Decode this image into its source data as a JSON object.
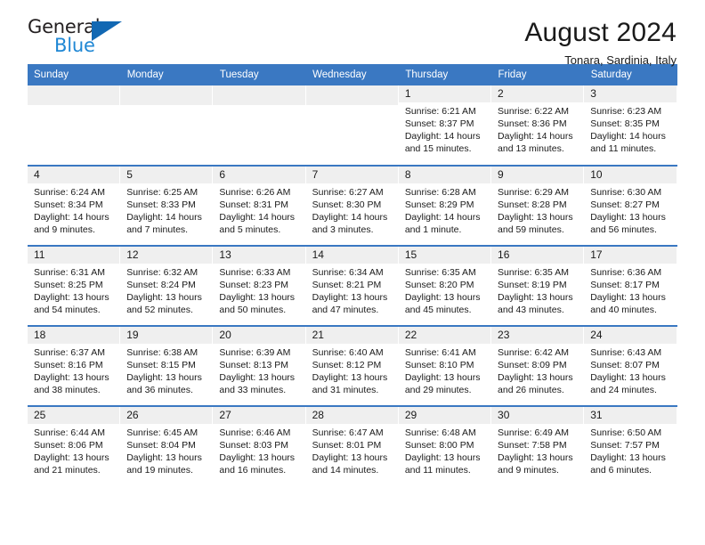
{
  "brand": {
    "name_top": "General",
    "name_bottom": "Blue",
    "triangle_color": "#1268b3",
    "blue_color": "#1f87d4"
  },
  "header": {
    "title": "August 2024",
    "subtitle": "Tonara, Sardinia, Italy"
  },
  "theme": {
    "header_bg": "#3a78c2",
    "header_text": "#ffffff",
    "daynum_bg": "#efefef",
    "row_divider": "#3a78c2"
  },
  "calendar": {
    "weekdays": [
      "Sunday",
      "Monday",
      "Tuesday",
      "Wednesday",
      "Thursday",
      "Friday",
      "Saturday"
    ],
    "weeks": [
      [
        {
          "day": "",
          "sunrise": "",
          "sunset": "",
          "daylight": "",
          "empty": true
        },
        {
          "day": "",
          "sunrise": "",
          "sunset": "",
          "daylight": "",
          "empty": true
        },
        {
          "day": "",
          "sunrise": "",
          "sunset": "",
          "daylight": "",
          "empty": true
        },
        {
          "day": "",
          "sunrise": "",
          "sunset": "",
          "daylight": "",
          "empty": true
        },
        {
          "day": "1",
          "sunrise": "Sunrise: 6:21 AM",
          "sunset": "Sunset: 8:37 PM",
          "daylight": "Daylight: 14 hours and 15 minutes."
        },
        {
          "day": "2",
          "sunrise": "Sunrise: 6:22 AM",
          "sunset": "Sunset: 8:36 PM",
          "daylight": "Daylight: 14 hours and 13 minutes."
        },
        {
          "day": "3",
          "sunrise": "Sunrise: 6:23 AM",
          "sunset": "Sunset: 8:35 PM",
          "daylight": "Daylight: 14 hours and 11 minutes."
        }
      ],
      [
        {
          "day": "4",
          "sunrise": "Sunrise: 6:24 AM",
          "sunset": "Sunset: 8:34 PM",
          "daylight": "Daylight: 14 hours and 9 minutes."
        },
        {
          "day": "5",
          "sunrise": "Sunrise: 6:25 AM",
          "sunset": "Sunset: 8:33 PM",
          "daylight": "Daylight: 14 hours and 7 minutes."
        },
        {
          "day": "6",
          "sunrise": "Sunrise: 6:26 AM",
          "sunset": "Sunset: 8:31 PM",
          "daylight": "Daylight: 14 hours and 5 minutes."
        },
        {
          "day": "7",
          "sunrise": "Sunrise: 6:27 AM",
          "sunset": "Sunset: 8:30 PM",
          "daylight": "Daylight: 14 hours and 3 minutes."
        },
        {
          "day": "8",
          "sunrise": "Sunrise: 6:28 AM",
          "sunset": "Sunset: 8:29 PM",
          "daylight": "Daylight: 14 hours and 1 minute."
        },
        {
          "day": "9",
          "sunrise": "Sunrise: 6:29 AM",
          "sunset": "Sunset: 8:28 PM",
          "daylight": "Daylight: 13 hours and 59 minutes."
        },
        {
          "day": "10",
          "sunrise": "Sunrise: 6:30 AM",
          "sunset": "Sunset: 8:27 PM",
          "daylight": "Daylight: 13 hours and 56 minutes."
        }
      ],
      [
        {
          "day": "11",
          "sunrise": "Sunrise: 6:31 AM",
          "sunset": "Sunset: 8:25 PM",
          "daylight": "Daylight: 13 hours and 54 minutes."
        },
        {
          "day": "12",
          "sunrise": "Sunrise: 6:32 AM",
          "sunset": "Sunset: 8:24 PM",
          "daylight": "Daylight: 13 hours and 52 minutes."
        },
        {
          "day": "13",
          "sunrise": "Sunrise: 6:33 AM",
          "sunset": "Sunset: 8:23 PM",
          "daylight": "Daylight: 13 hours and 50 minutes."
        },
        {
          "day": "14",
          "sunrise": "Sunrise: 6:34 AM",
          "sunset": "Sunset: 8:21 PM",
          "daylight": "Daylight: 13 hours and 47 minutes."
        },
        {
          "day": "15",
          "sunrise": "Sunrise: 6:35 AM",
          "sunset": "Sunset: 8:20 PM",
          "daylight": "Daylight: 13 hours and 45 minutes."
        },
        {
          "day": "16",
          "sunrise": "Sunrise: 6:35 AM",
          "sunset": "Sunset: 8:19 PM",
          "daylight": "Daylight: 13 hours and 43 minutes."
        },
        {
          "day": "17",
          "sunrise": "Sunrise: 6:36 AM",
          "sunset": "Sunset: 8:17 PM",
          "daylight": "Daylight: 13 hours and 40 minutes."
        }
      ],
      [
        {
          "day": "18",
          "sunrise": "Sunrise: 6:37 AM",
          "sunset": "Sunset: 8:16 PM",
          "daylight": "Daylight: 13 hours and 38 minutes."
        },
        {
          "day": "19",
          "sunrise": "Sunrise: 6:38 AM",
          "sunset": "Sunset: 8:15 PM",
          "daylight": "Daylight: 13 hours and 36 minutes."
        },
        {
          "day": "20",
          "sunrise": "Sunrise: 6:39 AM",
          "sunset": "Sunset: 8:13 PM",
          "daylight": "Daylight: 13 hours and 33 minutes."
        },
        {
          "day": "21",
          "sunrise": "Sunrise: 6:40 AM",
          "sunset": "Sunset: 8:12 PM",
          "daylight": "Daylight: 13 hours and 31 minutes."
        },
        {
          "day": "22",
          "sunrise": "Sunrise: 6:41 AM",
          "sunset": "Sunset: 8:10 PM",
          "daylight": "Daylight: 13 hours and 29 minutes."
        },
        {
          "day": "23",
          "sunrise": "Sunrise: 6:42 AM",
          "sunset": "Sunset: 8:09 PM",
          "daylight": "Daylight: 13 hours and 26 minutes."
        },
        {
          "day": "24",
          "sunrise": "Sunrise: 6:43 AM",
          "sunset": "Sunset: 8:07 PM",
          "daylight": "Daylight: 13 hours and 24 minutes."
        }
      ],
      [
        {
          "day": "25",
          "sunrise": "Sunrise: 6:44 AM",
          "sunset": "Sunset: 8:06 PM",
          "daylight": "Daylight: 13 hours and 21 minutes."
        },
        {
          "day": "26",
          "sunrise": "Sunrise: 6:45 AM",
          "sunset": "Sunset: 8:04 PM",
          "daylight": "Daylight: 13 hours and 19 minutes."
        },
        {
          "day": "27",
          "sunrise": "Sunrise: 6:46 AM",
          "sunset": "Sunset: 8:03 PM",
          "daylight": "Daylight: 13 hours and 16 minutes."
        },
        {
          "day": "28",
          "sunrise": "Sunrise: 6:47 AM",
          "sunset": "Sunset: 8:01 PM",
          "daylight": "Daylight: 13 hours and 14 minutes."
        },
        {
          "day": "29",
          "sunrise": "Sunrise: 6:48 AM",
          "sunset": "Sunset: 8:00 PM",
          "daylight": "Daylight: 13 hours and 11 minutes."
        },
        {
          "day": "30",
          "sunrise": "Sunrise: 6:49 AM",
          "sunset": "Sunset: 7:58 PM",
          "daylight": "Daylight: 13 hours and 9 minutes."
        },
        {
          "day": "31",
          "sunrise": "Sunrise: 6:50 AM",
          "sunset": "Sunset: 7:57 PM",
          "daylight": "Daylight: 13 hours and 6 minutes."
        }
      ]
    ]
  }
}
